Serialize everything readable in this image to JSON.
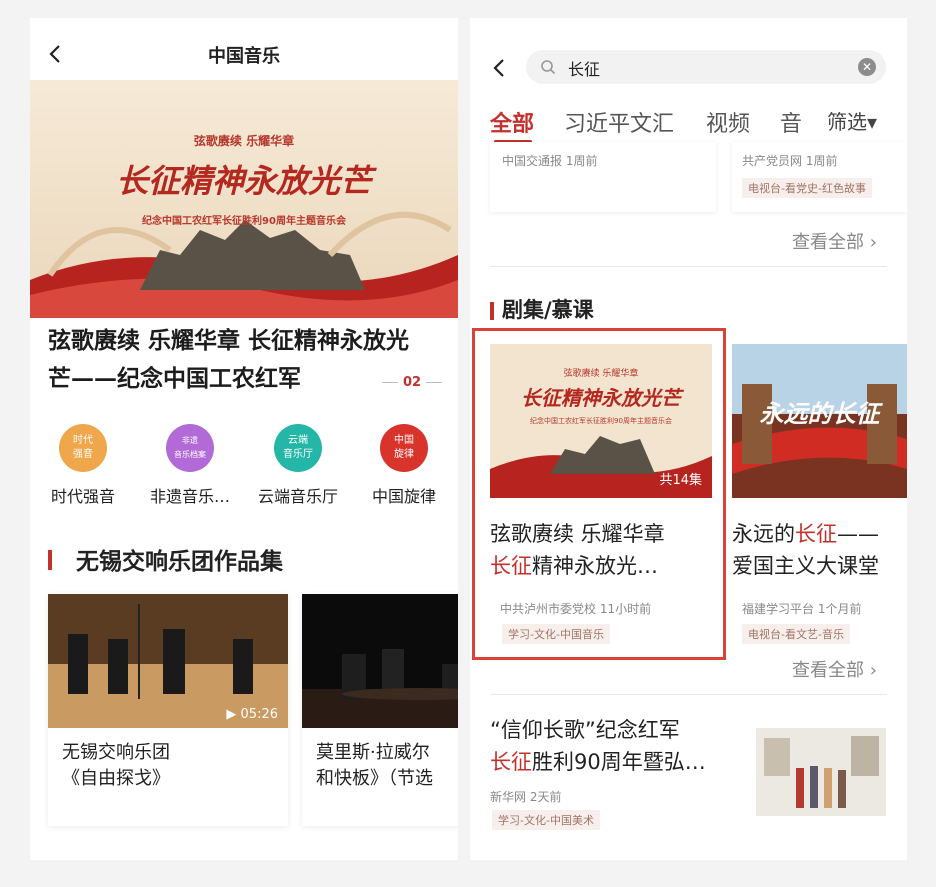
{
  "left": {
    "title": "中国音乐",
    "banner": {
      "top_line": "弦歌赓续  乐耀华章",
      "calligraphy": "长征精神永放光芒",
      "subtitle": "纪念中国工农红军长征胜利90周年主题音乐会"
    },
    "headline": "弦歌赓续  乐耀华章  长征精神永放光芒——纪念中国工农红军",
    "pager": "02",
    "categories": [
      {
        "icon_text": "时代\n强音",
        "label": "时代强音",
        "color": "#f0a64a"
      },
      {
        "icon_text": "非遗\n音乐档案",
        "label": "非遗音乐…",
        "color": "#b26bd6"
      },
      {
        "icon_text": "云端\n音乐厅",
        "label": "云端音乐厅",
        "color": "#24b6a6"
      },
      {
        "icon_text": "中国\n旋律",
        "label": "中国旋律",
        "color": "#d9342b"
      }
    ],
    "section_title": "无锡交响乐团作品集",
    "videos": [
      {
        "duration": "05:26",
        "title": "无锡交响乐团\n《自由探戈》"
      },
      {
        "duration": "",
        "title": "莫里斯·拉威尔\n和快板》（节选"
      }
    ]
  },
  "right": {
    "search_query": "长征",
    "tabs": [
      {
        "label": "全部",
        "active": true
      },
      {
        "label": "习近平文汇",
        "active": false
      },
      {
        "label": "视频",
        "active": false
      },
      {
        "label": "音",
        "active": false
      }
    ],
    "filter_label": "筛选▾",
    "top_cards": [
      {
        "meta": "中国交通报  1周前",
        "tag": ""
      },
      {
        "meta": "共产党员网  1周前",
        "tag": "电视台-看党史-红色故事"
      }
    ],
    "see_all": "查看全部 ›",
    "section_title": "剧集/慕课",
    "series": [
      {
        "title_a": "弦歌赓续  乐耀华章",
        "title_hl": "长征",
        "title_b": "精神永放光…",
        "count": "共14集",
        "meta": "中共泸州市委党校  11小时前",
        "tag": "学习-文化-中国音乐",
        "thumb_title": "长征精神永放光芒",
        "thumb_top": "弦歌赓续  乐耀华章",
        "thumb_sub": "纪念中国工农红军长征胜利90周年主题音乐会"
      },
      {
        "title_a": "永远的",
        "title_hl": "长征",
        "title_b": "——\n爱国主义大课堂",
        "count": "",
        "meta": "福建学习平台  1个月前",
        "tag": "电视台-看文艺-音乐",
        "thumb_title": "永远的长征"
      }
    ],
    "see_all_2": "查看全部 ›",
    "article": {
      "title_a": "“信仰长歌”纪念红军",
      "title_hl": "长征",
      "title_b": "胜利90周年暨弘…",
      "meta": "新华网  2天前",
      "tag": "学习-文化-中国美术"
    }
  },
  "colors": {
    "accent": "#c4302b",
    "highlight_box": "#d94236"
  }
}
